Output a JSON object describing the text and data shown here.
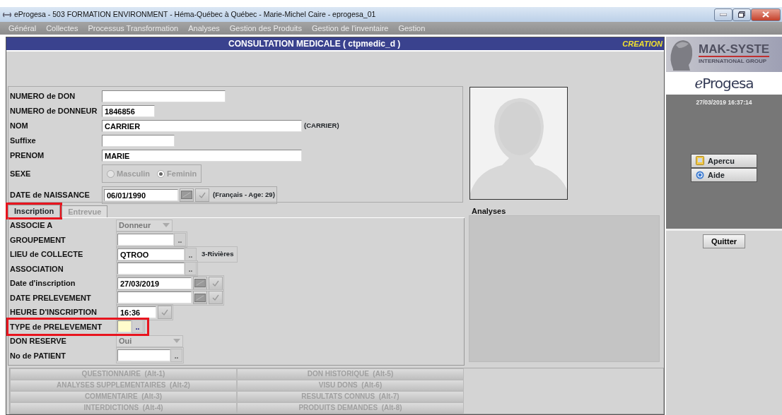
{
  "window": {
    "title": "eProgesa - 503 FORMATION ENVIRONMENT - Héma-Québec à Québec - Marie-Michel Caire - eprogesa_01"
  },
  "menu": [
    {
      "label": "Général",
      "disabled": true
    },
    {
      "label": "Collectes",
      "disabled": true
    },
    {
      "label": "Processus Transformation",
      "disabled": true
    },
    {
      "label": "Analyses",
      "disabled": true
    },
    {
      "label": "Gestion des Produits",
      "disabled": true
    },
    {
      "label": "Gestion de l'inventaire",
      "disabled": true
    },
    {
      "label": "Gestion",
      "disabled": true
    }
  ],
  "form": {
    "title": "CONSULTATION MEDICALE ( ctpmedic_d )",
    "mode": "CREATION"
  },
  "identity_fields": [
    {
      "kind": "text",
      "label": "NUMERO de DON"
    },
    {
      "kind": "text",
      "label": "NUMERO de DONNEUR",
      "value": "1846856"
    },
    {
      "kind": "text",
      "label": "NOM",
      "value": "CARRIER",
      "note": "(CARRIER)"
    },
    {
      "kind": "text",
      "label": "Suffixe"
    },
    {
      "kind": "text",
      "label": "PRENOM",
      "value": "MARIE"
    },
    {
      "kind": "radio",
      "label": "SEXE",
      "disabled": true,
      "options": [
        {
          "label": "Masculin",
          "selected": false
        },
        {
          "label": "Feminin",
          "selected": true
        }
      ]
    },
    {
      "kind": "date",
      "label": "DATE de NAISSANCE",
      "value": "06/01/1990",
      "note": "(Français - Age: 29)"
    }
  ],
  "tabs": [
    {
      "label": "Inscription",
      "selected": true,
      "disabled": false,
      "highlighted": true
    },
    {
      "label": "Entrevue",
      "selected": false,
      "disabled": true,
      "highlighted": false
    }
  ],
  "inscription_fields": [
    {
      "kind": "select",
      "label": "ASSOCIE A",
      "value": "Donneur",
      "disabled": true,
      "highlighted": false
    },
    {
      "kind": "lookup",
      "label": "GROUPEMENT",
      "button": "..",
      "highlighted": false
    },
    {
      "kind": "lookup",
      "label": "LIEU de COLLECTE",
      "value": "QTROO",
      "button": "..",
      "note": "3-Rivières",
      "highlighted": false
    },
    {
      "kind": "lookup",
      "label": "ASSOCIATION",
      "button": "..",
      "highlighted": false
    },
    {
      "kind": "date",
      "label": "Date d'inscription",
      "value": "27/03/2019",
      "highlighted": false
    },
    {
      "kind": "date",
      "label": "DATE PRELEVEMENT",
      "highlighted": false
    },
    {
      "kind": "time",
      "label": "HEURE D'INSCRIPTION",
      "value": "16:36",
      "highlighted": false
    },
    {
      "kind": "lookup",
      "label": "TYPE de PRELEVEMENT",
      "button": "..",
      "focused": true,
      "highlighted": true
    },
    {
      "kind": "select",
      "label": "DON RESERVE",
      "value": "Oui",
      "disabled": true,
      "highlighted": false
    },
    {
      "kind": "lookup",
      "label": "No de PATIENT",
      "button": "..",
      "highlighted": false
    }
  ],
  "analyses": {
    "title": "Analyses"
  },
  "actions": [
    {
      "label": "QUESTIONNAIRE  (Alt-1)",
      "disabled": true
    },
    {
      "label": "DON HISTORIQUE  (Alt-5)",
      "disabled": true
    },
    {
      "label": "ANALYSES SUPPLEMENTAIRES  (Alt-2)",
      "disabled": true
    },
    {
      "label": "VISU DONS  (Alt-6)",
      "disabled": true
    },
    {
      "label": "COMMENTAIRE  (Alt-3)",
      "disabled": true
    },
    {
      "label": "RESULTATS CONNUS  (Alt-7)",
      "disabled": true
    },
    {
      "label": "INTERDICTIONS  (Alt-4)",
      "disabled": true
    },
    {
      "label": "PRODUITS DEMANDES  (Alt-8)",
      "disabled": true
    }
  ],
  "sidebar": {
    "brand": "MAK-SYSTE",
    "tagline": "INTERNATIONAL GROUP",
    "app_name_prefix": "e",
    "app_name": "Progesa",
    "timestamp": "27/03/2019 16:37:14",
    "buttons": [
      {
        "kind": "preview",
        "label": "Apercu"
      },
      {
        "kind": "help",
        "label": "Aide"
      }
    ],
    "quit": "Quitter"
  }
}
